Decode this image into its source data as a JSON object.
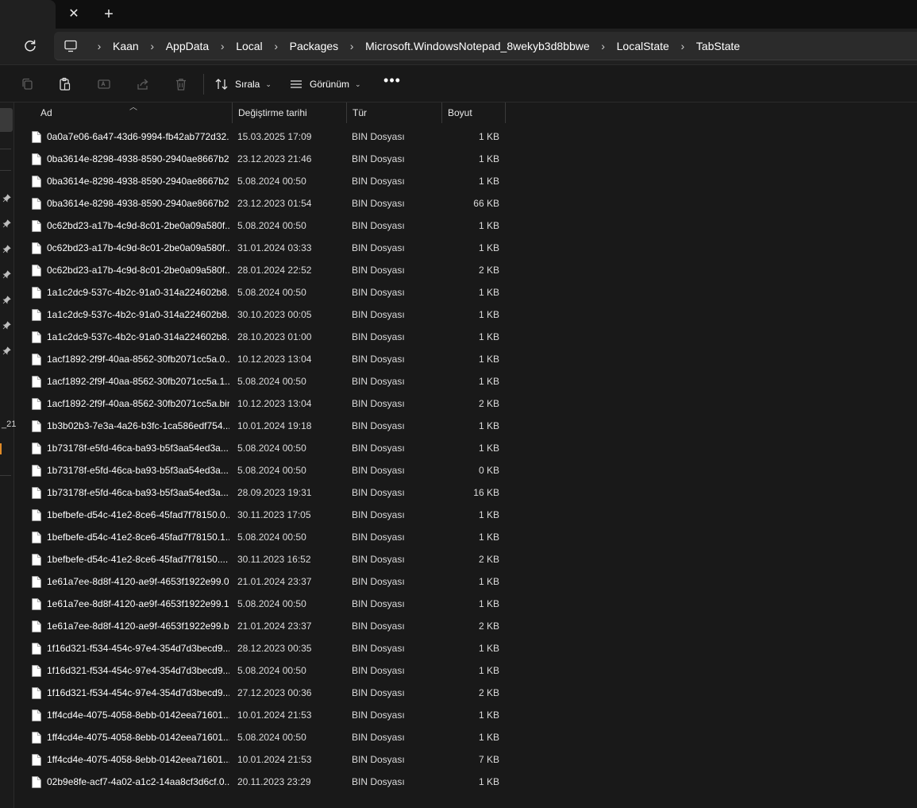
{
  "tabs": {
    "close_glyph": "✕",
    "new_glyph": "+"
  },
  "breadcrumb": [
    "Kaan",
    "AppData",
    "Local",
    "Packages",
    "Microsoft.WindowsNotepad_8wekyb3d8bbwe",
    "LocalState",
    "TabState"
  ],
  "toolbar": {
    "sort_label": "Sırala",
    "view_label": "Görünüm",
    "more_glyph": "•••"
  },
  "columns": {
    "name": "Ad",
    "date": "Değiştirme tarihi",
    "type": "Tür",
    "size": "Boyut"
  },
  "nav_fragment": "_21",
  "files": [
    {
      "name": "0a0a7e06-6a47-43d6-9994-fb42ab772d32....",
      "date": "15.03.2025 17:09",
      "type": "BIN Dosyası",
      "size": "1 KB"
    },
    {
      "name": "0ba3614e-8298-4938-8590-2940ae8667b2....",
      "date": "23.12.2023 21:46",
      "type": "BIN Dosyası",
      "size": "1 KB"
    },
    {
      "name": "0ba3614e-8298-4938-8590-2940ae8667b2....",
      "date": "5.08.2024 00:50",
      "type": "BIN Dosyası",
      "size": "1 KB"
    },
    {
      "name": "0ba3614e-8298-4938-8590-2940ae8667b2....",
      "date": "23.12.2023 01:54",
      "type": "BIN Dosyası",
      "size": "66 KB"
    },
    {
      "name": "0c62bd23-a17b-4c9d-8c01-2be0a09a580f....",
      "date": "5.08.2024 00:50",
      "type": "BIN Dosyası",
      "size": "1 KB"
    },
    {
      "name": "0c62bd23-a17b-4c9d-8c01-2be0a09a580f....",
      "date": "31.01.2024 03:33",
      "type": "BIN Dosyası",
      "size": "1 KB"
    },
    {
      "name": "0c62bd23-a17b-4c9d-8c01-2be0a09a580f....",
      "date": "28.01.2024 22:52",
      "type": "BIN Dosyası",
      "size": "2 KB"
    },
    {
      "name": "1a1c2dc9-537c-4b2c-91a0-314a224602b8....",
      "date": "5.08.2024 00:50",
      "type": "BIN Dosyası",
      "size": "1 KB"
    },
    {
      "name": "1a1c2dc9-537c-4b2c-91a0-314a224602b8....",
      "date": "30.10.2023 00:05",
      "type": "BIN Dosyası",
      "size": "1 KB"
    },
    {
      "name": "1a1c2dc9-537c-4b2c-91a0-314a224602b8....",
      "date": "28.10.2023 01:00",
      "type": "BIN Dosyası",
      "size": "1 KB"
    },
    {
      "name": "1acf1892-2f9f-40aa-8562-30fb2071cc5a.0....",
      "date": "10.12.2023 13:04",
      "type": "BIN Dosyası",
      "size": "1 KB"
    },
    {
      "name": "1acf1892-2f9f-40aa-8562-30fb2071cc5a.1....",
      "date": "5.08.2024 00:50",
      "type": "BIN Dosyası",
      "size": "1 KB"
    },
    {
      "name": "1acf1892-2f9f-40aa-8562-30fb2071cc5a.bin",
      "date": "10.12.2023 13:04",
      "type": "BIN Dosyası",
      "size": "2 KB"
    },
    {
      "name": "1b3b02b3-7e3a-4a26-b3fc-1ca586edf754....",
      "date": "10.01.2024 19:18",
      "type": "BIN Dosyası",
      "size": "1 KB"
    },
    {
      "name": "1b73178f-e5fd-46ca-ba93-b5f3aa54ed3a....",
      "date": "5.08.2024 00:50",
      "type": "BIN Dosyası",
      "size": "1 KB"
    },
    {
      "name": "1b73178f-e5fd-46ca-ba93-b5f3aa54ed3a....",
      "date": "5.08.2024 00:50",
      "type": "BIN Dosyası",
      "size": "0 KB"
    },
    {
      "name": "1b73178f-e5fd-46ca-ba93-b5f3aa54ed3a....",
      "date": "28.09.2023 19:31",
      "type": "BIN Dosyası",
      "size": "16 KB"
    },
    {
      "name": "1befbefe-d54c-41e2-8ce6-45fad7f78150.0....",
      "date": "30.11.2023 17:05",
      "type": "BIN Dosyası",
      "size": "1 KB"
    },
    {
      "name": "1befbefe-d54c-41e2-8ce6-45fad7f78150.1....",
      "date": "5.08.2024 00:50",
      "type": "BIN Dosyası",
      "size": "1 KB"
    },
    {
      "name": "1befbefe-d54c-41e2-8ce6-45fad7f78150....",
      "date": "30.11.2023 16:52",
      "type": "BIN Dosyası",
      "size": "2 KB"
    },
    {
      "name": "1e61a7ee-8d8f-4120-ae9f-4653f1922e99.0....",
      "date": "21.01.2024 23:37",
      "type": "BIN Dosyası",
      "size": "1 KB"
    },
    {
      "name": "1e61a7ee-8d8f-4120-ae9f-4653f1922e99.1....",
      "date": "5.08.2024 00:50",
      "type": "BIN Dosyası",
      "size": "1 KB"
    },
    {
      "name": "1e61a7ee-8d8f-4120-ae9f-4653f1922e99.b....",
      "date": "21.01.2024 23:37",
      "type": "BIN Dosyası",
      "size": "2 KB"
    },
    {
      "name": "1f16d321-f534-454c-97e4-354d7d3becd9....",
      "date": "28.12.2023 00:35",
      "type": "BIN Dosyası",
      "size": "1 KB"
    },
    {
      "name": "1f16d321-f534-454c-97e4-354d7d3becd9....",
      "date": "5.08.2024 00:50",
      "type": "BIN Dosyası",
      "size": "1 KB"
    },
    {
      "name": "1f16d321-f534-454c-97e4-354d7d3becd9....",
      "date": "27.12.2023 00:36",
      "type": "BIN Dosyası",
      "size": "2 KB"
    },
    {
      "name": "1ff4cd4e-4075-4058-8ebb-0142eea71601....",
      "date": "10.01.2024 21:53",
      "type": "BIN Dosyası",
      "size": "1 KB"
    },
    {
      "name": "1ff4cd4e-4075-4058-8ebb-0142eea71601....",
      "date": "5.08.2024 00:50",
      "type": "BIN Dosyası",
      "size": "1 KB"
    },
    {
      "name": "1ff4cd4e-4075-4058-8ebb-0142eea71601....",
      "date": "10.01.2024 21:53",
      "type": "BIN Dosyası",
      "size": "7 KB"
    },
    {
      "name": "02b9e8fe-acf7-4a02-a1c2-14aa8cf3d6cf.0....",
      "date": "20.11.2023 23:29",
      "type": "BIN Dosyası",
      "size": "1 KB"
    }
  ]
}
